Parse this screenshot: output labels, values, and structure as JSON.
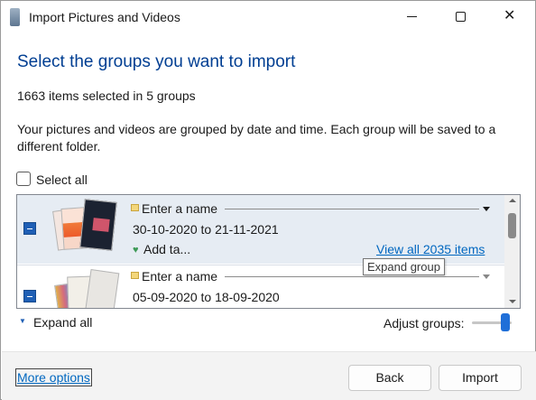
{
  "window": {
    "title": "Import Pictures and Videos",
    "controls": {
      "minimize": "minimize-icon",
      "maximize": "maximize-icon",
      "close": "close-icon",
      "close_glyph": "✕"
    }
  },
  "heading": "Select the groups you want to import",
  "summary": "1663 items selected in 5 groups",
  "description": "Your pictures and videos are grouped by date and time. Each group will be saved to a different folder.",
  "select_all": {
    "label": "Select all",
    "checked": false
  },
  "groups": [
    {
      "name_placeholder": "Enter a name",
      "date_range": "30-10-2020 to 21-11-2021",
      "tag_icon": "♥",
      "tag_label": "Add ta...",
      "view_all": "View all 2035 items",
      "checked": "partial"
    },
    {
      "name_placeholder": "Enter a name",
      "date_range": "05-09-2020 to 18-09-2020",
      "checked": "partial"
    }
  ],
  "tooltip": "Expand group",
  "expand_all": {
    "icon": "▼",
    "label": "Expand all"
  },
  "adjust_groups": {
    "label": "Adjust groups:"
  },
  "footer": {
    "more_options": "More options",
    "back": "Back",
    "import": "Import"
  },
  "colors": {
    "accent": "#1f6fd8",
    "heading": "#003e92",
    "link": "#0067c0",
    "selected_row": "#e6ecf3"
  }
}
